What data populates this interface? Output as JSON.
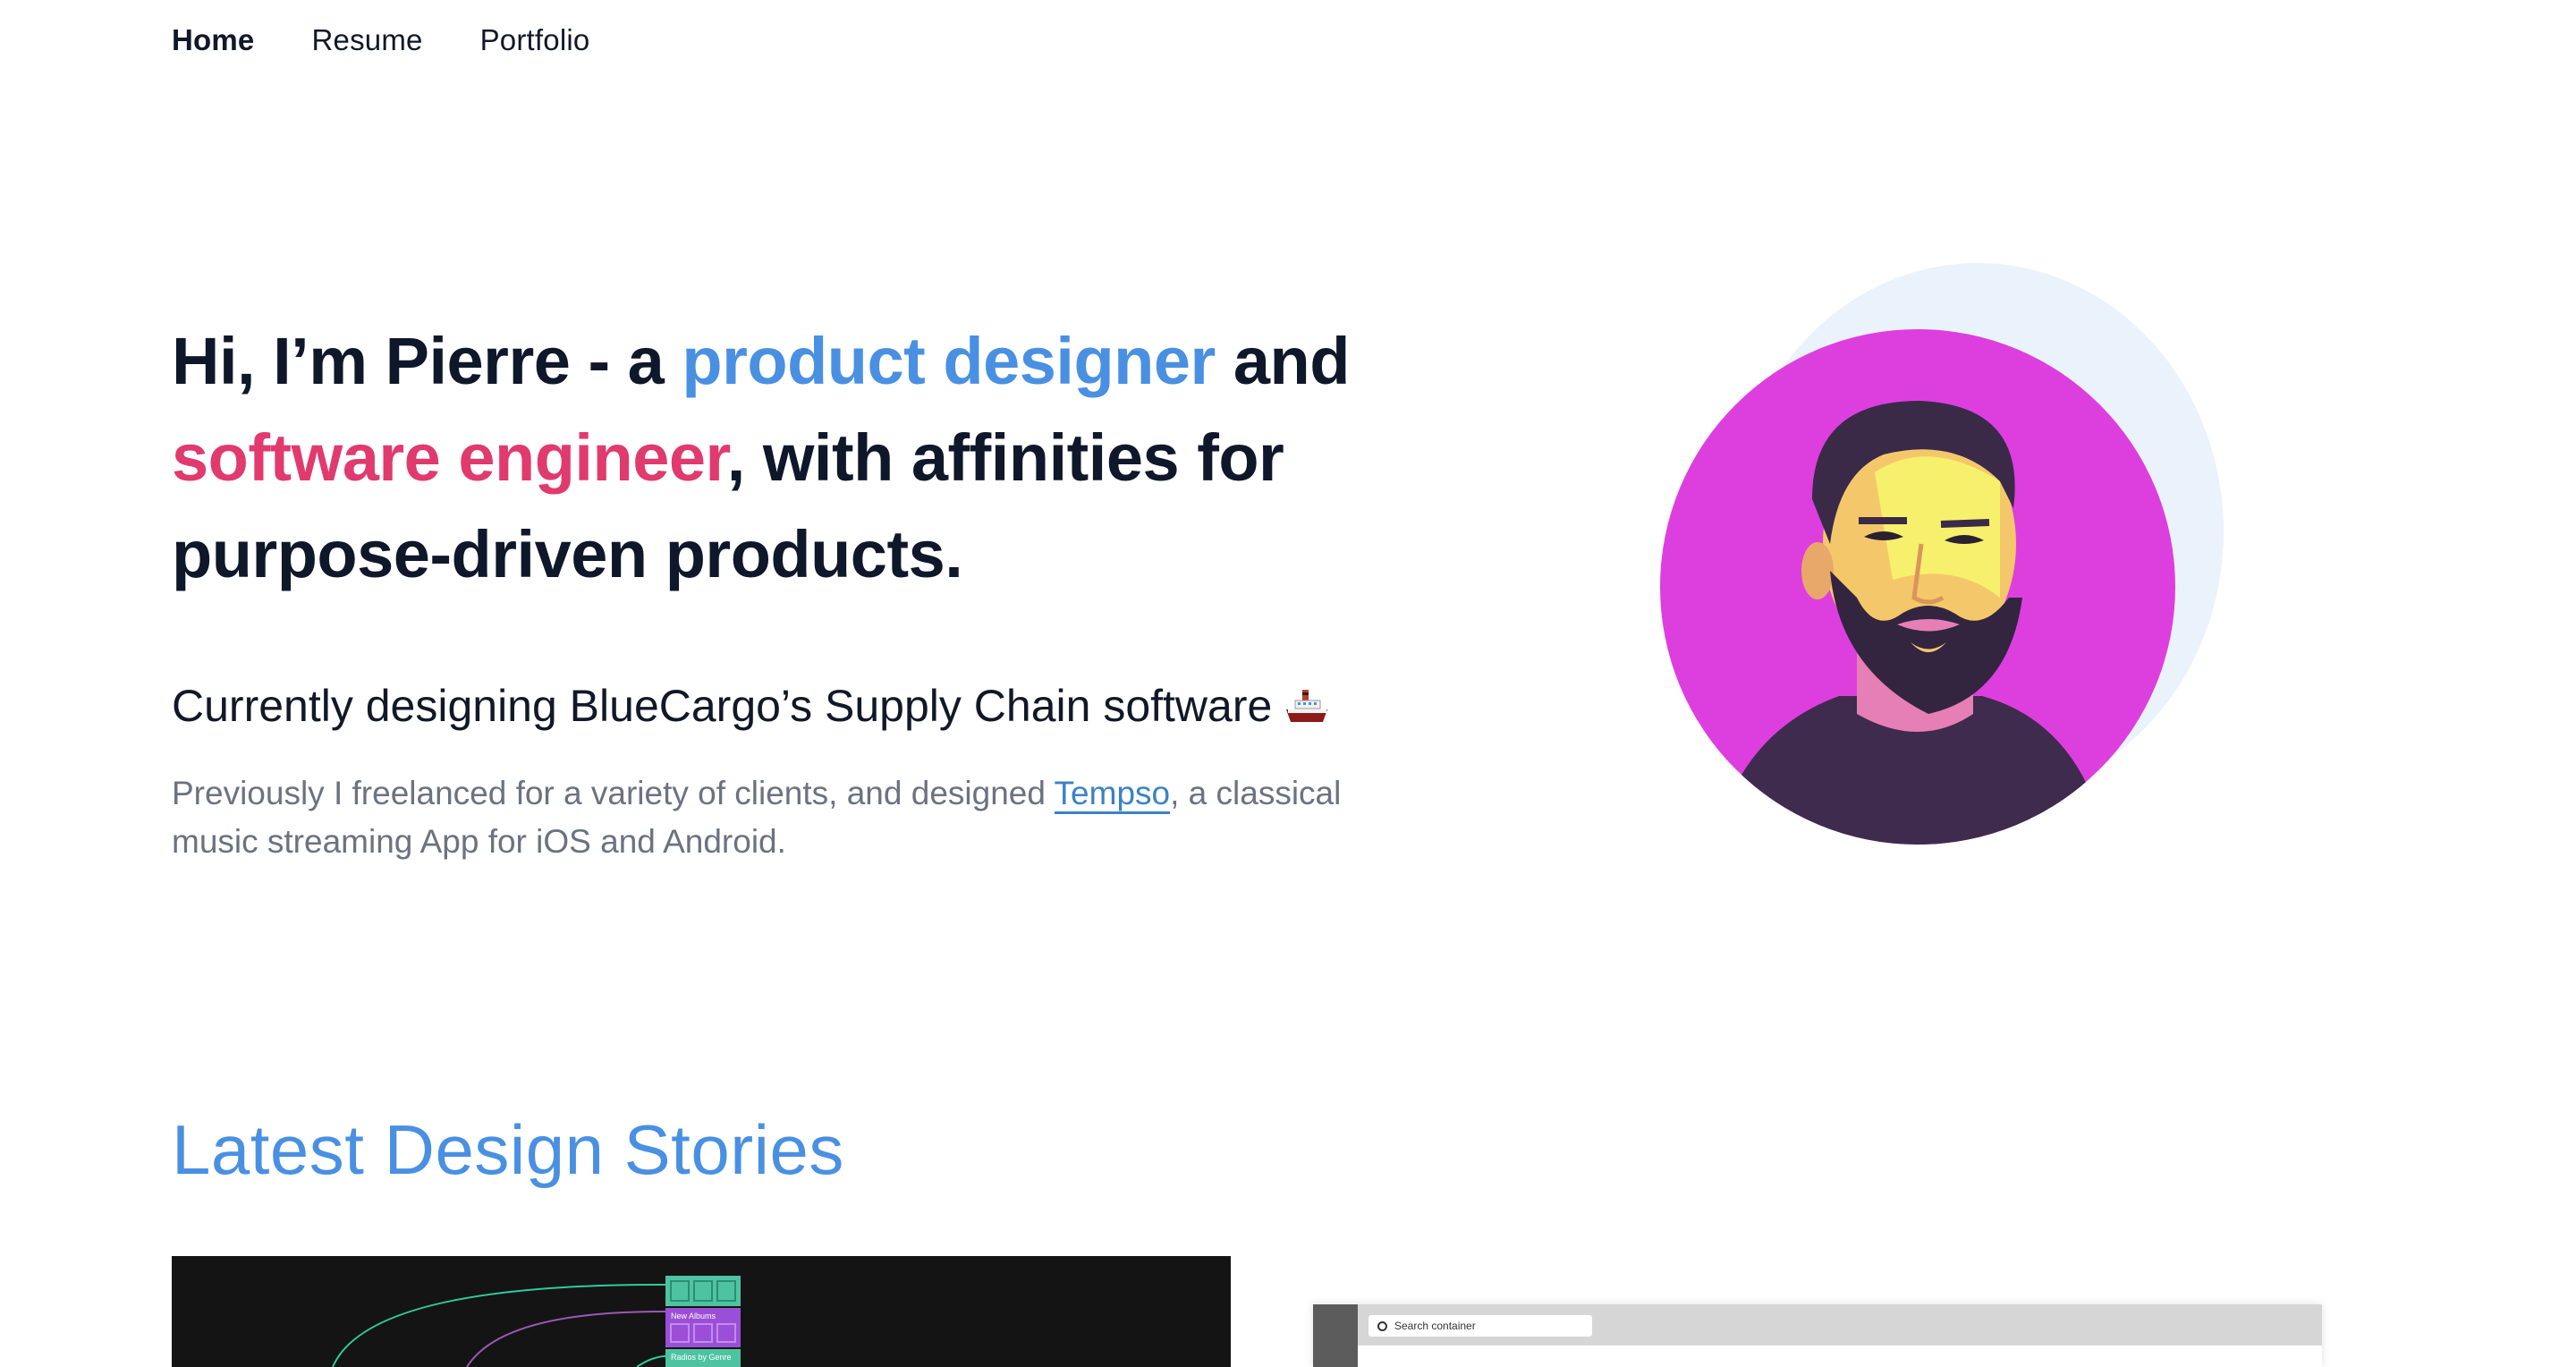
{
  "nav": {
    "items": [
      {
        "label": "Home",
        "active": true
      },
      {
        "label": "Resume",
        "active": false
      },
      {
        "label": "Portfolio",
        "active": false
      }
    ]
  },
  "hero": {
    "part1": "Hi, I’m Pierre - a ",
    "highlight1": "product designer",
    "part2": " and",
    "highlight2": "software engineer",
    "part3": ", with affinities for purpose-driven products.",
    "highlight1_color": "#4a90e2",
    "highlight2_color": "#e03a6e"
  },
  "current": {
    "text": "Currently designing BlueCargo’s Supply Chain software",
    "icon": "ship-icon"
  },
  "description": {
    "before": "Previously I freelanced for a variety of clients, and designed ",
    "link": "Tempso",
    "after": ", a classical music streaming App for iOS and Android."
  },
  "avatar": {
    "icon": "portrait-illustration",
    "background_color": "#dd3fdf"
  },
  "stories": {
    "title": "Latest Design Stories"
  },
  "cards": {
    "card1": {
      "labels": [
        "New Albums",
        "Radios by Genre"
      ]
    },
    "card2": {
      "search_placeholder": "Search container"
    }
  }
}
